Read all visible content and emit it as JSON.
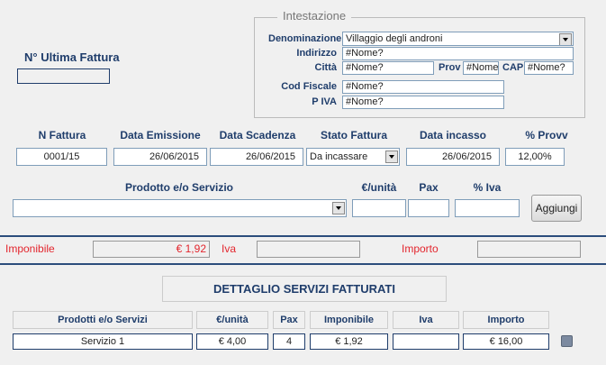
{
  "left": {
    "ultima_fattura_label": "N° Ultima Fattura",
    "ultima_fattura_value": ""
  },
  "intestazione": {
    "legend": "Intestazione",
    "denominazione_label": "Denominazione",
    "denominazione_value": "Villaggio degli androni",
    "indirizzo_label": "Indirizzo",
    "indirizzo_value": "#Nome?",
    "citta_label": "Città",
    "citta_value": "#Nome?",
    "prov_label": "Prov",
    "prov_value": "#Nome",
    "cap_label": "CAP",
    "cap_value": "#Nome?",
    "codfiscale_label": "Cod Fiscale",
    "codfiscale_value": "#Nome?",
    "piva_label": "P IVA",
    "piva_value": "#Nome?"
  },
  "fattura": {
    "n_fattura_label": "N Fattura",
    "n_fattura_value": "0001/15",
    "data_emissione_label": "Data Emissione",
    "data_emissione_value": "26/06/2015",
    "data_scadenza_label": "Data Scadenza",
    "data_scadenza_value": "26/06/2015",
    "stato_label": "Stato Fattura",
    "stato_value": "Da incassare",
    "data_incasso_label": "Data incasso",
    "data_incasso_value": "26/06/2015",
    "provv_label": "% Provv",
    "provv_value": "12,00%"
  },
  "prodotto": {
    "prodotto_label": "Prodotto e/o Servizio",
    "prodotto_value": "",
    "eur_unita_label": "€/unità",
    "eur_unita_value": "",
    "pax_label": "Pax",
    "pax_value": "",
    "iva_label": "% Iva",
    "iva_value": "",
    "aggiungi_label": "Aggiungi"
  },
  "totali": {
    "imponibile_label": "Imponibile",
    "imponibile_value": "€ 1,92",
    "iva_label": "Iva",
    "iva_value": "",
    "importo_label": "Importo",
    "importo_value": ""
  },
  "dettaglio": {
    "title": "DETTAGLIO SERVIZI FATTURATI",
    "headers": [
      "Prodotti e/o Servizi",
      "€/unità",
      "Pax",
      "Imponibile",
      "Iva",
      "Importo"
    ],
    "rows": [
      {
        "prodotto": "Servizio 1",
        "eur_unita": "€ 4,00",
        "pax": "4",
        "imponibile": "€ 1,92",
        "iva": "",
        "importo": "€ 16,00"
      }
    ]
  }
}
